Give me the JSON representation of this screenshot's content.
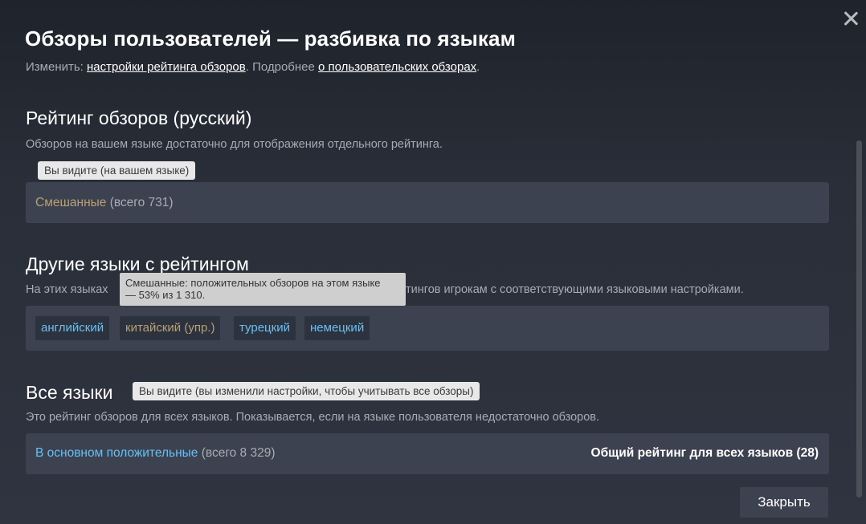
{
  "modal": {
    "title": "Обзоры пользователей — разбивка по языкам",
    "subtitle_prefix": "Изменить: ",
    "subtitle_link1": "настройки рейтинга обзоров",
    "subtitle_mid": ". Подробнее ",
    "subtitle_link2": "о пользовательских обзорах",
    "subtitle_suffix": ".",
    "close_icon": "close-icon"
  },
  "native": {
    "heading": "Рейтинг обзоров (русский)",
    "description": "Обзоров на вашем языке достаточно для отображения отдельного рейтинга.",
    "tooltip": "Вы видите (на вашем языке)",
    "rating": "Смешанные",
    "count": " (всего 731)"
  },
  "other": {
    "heading": "Другие языки с рейтингом",
    "description_start": "На этих языках",
    "description_end": "тингов игрокам с соответствующими языковыми настройками.",
    "tooltip_line1": "Смешанные: положительных обзоров на этом языке",
    "tooltip_line2": "— 53% из 1 310.",
    "languages": [
      {
        "label": "английский",
        "status": "positive"
      },
      {
        "label": "китайский (упр.)",
        "status": "mixed"
      },
      {
        "label": "турецкий",
        "status": "positive"
      },
      {
        "label": "немецкий",
        "status": "positive"
      }
    ]
  },
  "all": {
    "heading": "Все языки",
    "tooltip": "Вы видите (вы изменили настройки, чтобы учитывать все обзоры)",
    "description": "Это рейтинг обзоров для всех языков. Показывается, если на языке пользователя недостаточно обзоров.",
    "rating": "В основном положительные",
    "count": " (всего 8 329)",
    "overall_label": "Общий рейтинг для всех языков (28)"
  },
  "footer": {
    "close_label": "Закрыть"
  },
  "colors": {
    "mixed": "#b9a074",
    "positive": "#66c0f4",
    "background": "#2a2f38",
    "box": "#3d4250"
  }
}
